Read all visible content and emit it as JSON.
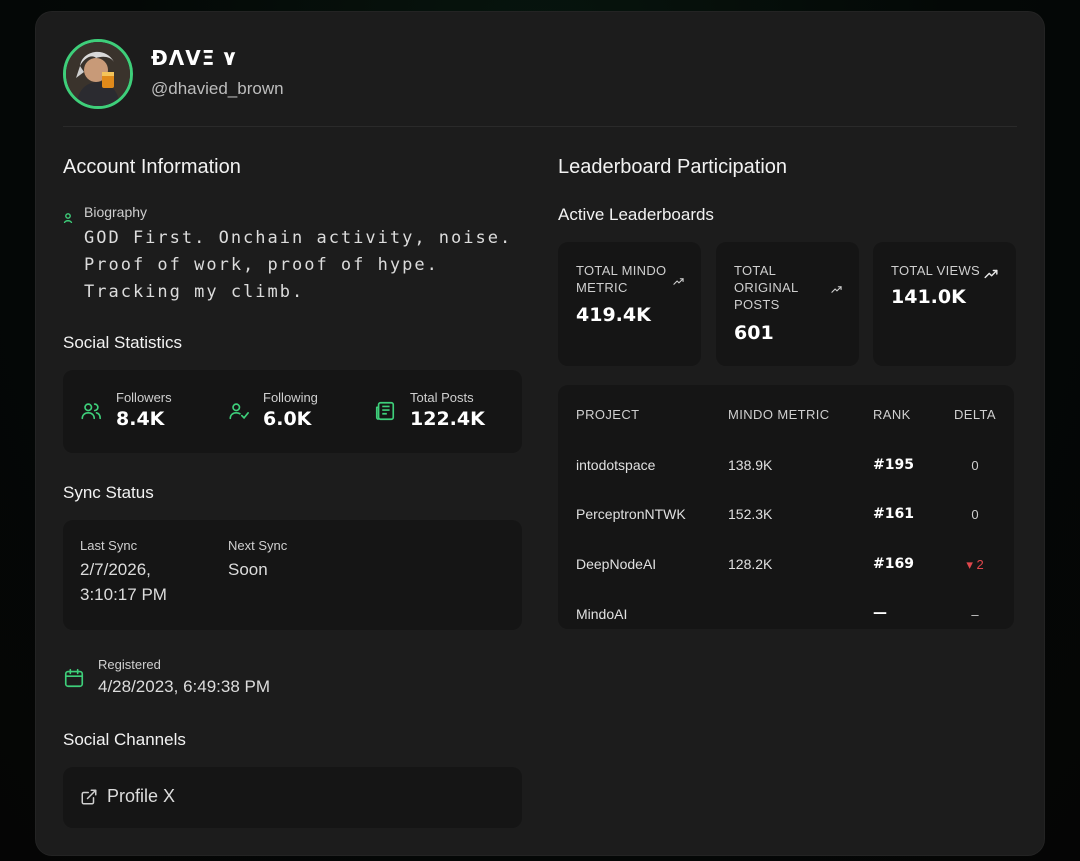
{
  "profile": {
    "display_name": "ÐΛVΞ ۷",
    "handle": "@dhavied_brown"
  },
  "account": {
    "title": "Account Information",
    "bio_label": "Biography",
    "bio_text": "GOD First. Onchain activity, noise. Proof of work, proof of hype. Tracking my climb."
  },
  "social_stats": {
    "title": "Social Statistics",
    "items": [
      {
        "label": "Followers",
        "value": "8.4K",
        "icon": "users-icon"
      },
      {
        "label": "Following",
        "value": "6.0K",
        "icon": "user-check-icon"
      },
      {
        "label": "Total Posts",
        "value": "122.4K",
        "icon": "newspaper-icon"
      }
    ]
  },
  "sync": {
    "title": "Sync Status",
    "last_label": "Last Sync",
    "last_value": "2/7/2026, 3:10:17 PM",
    "next_label": "Next Sync",
    "next_value": "Soon"
  },
  "registered": {
    "label": "Registered",
    "value": "4/28/2023, 6:49:38 PM"
  },
  "channels": {
    "title": "Social Channels",
    "profile_link": "Profile X"
  },
  "leaderboard": {
    "title": "Leaderboard Participation",
    "subtitle": "Active Leaderboards",
    "metrics": [
      {
        "label": "TOTAL MINDO METRIC",
        "value": "419.4K"
      },
      {
        "label": "TOTAL ORIGINAL POSTS",
        "value": "601"
      },
      {
        "label": "TOTAL VIEWS",
        "value": "141.0K"
      }
    ],
    "columns": [
      "PROJECT",
      "MINDO METRIC",
      "RANK",
      "DELTA"
    ],
    "rows": [
      {
        "project": "intodotspace",
        "metric": "138.9K",
        "rank": "#195",
        "delta": "0",
        "direction": "none"
      },
      {
        "project": "PerceptronNTWK",
        "metric": "152.3K",
        "rank": "#161",
        "delta": "0",
        "direction": "none"
      },
      {
        "project": "DeepNodeAI",
        "metric": "128.2K",
        "rank": "#169",
        "delta": "▾ 2",
        "direction": "down"
      },
      {
        "project": "MindoAI",
        "metric": "",
        "rank": "—",
        "delta": "–",
        "direction": "none"
      }
    ]
  },
  "colors": {
    "accent": "#3ecf7a",
    "card_bg": "#1c1c1c",
    "panel_bg": "#151515",
    "negative": "#e0474c"
  }
}
